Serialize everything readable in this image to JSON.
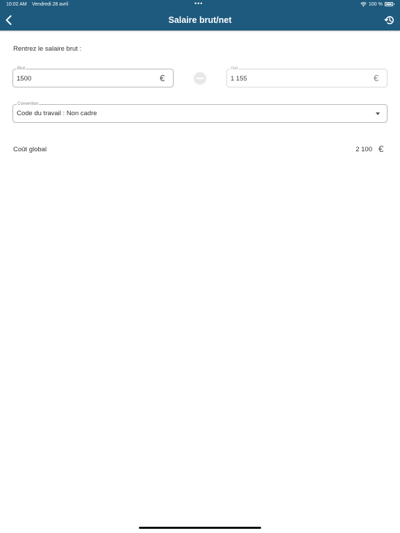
{
  "status_bar": {
    "time": "10:02 AM",
    "date": "Vendredi 28 avril",
    "dots": "•••",
    "battery_pct": "100 %",
    "icons": [
      "wifi-icon",
      "battery-icon"
    ]
  },
  "nav": {
    "title": "Salaire brut/net",
    "back_icon": "chevron-left-icon",
    "history_icon": "history-icon"
  },
  "form": {
    "prompt": "Rentrez le salaire brut :",
    "brut": {
      "legend": "Brut",
      "value": "1500",
      "unit": "€"
    },
    "net": {
      "legend": "Net",
      "value": "1 155",
      "unit": "€"
    },
    "swap_icon": "swap-icon",
    "convention": {
      "legend": "Convention",
      "value": "Code du travail : Non cadre"
    }
  },
  "cost": {
    "label": "Coût global",
    "value": "2 100",
    "unit": "€"
  },
  "colors": {
    "header": "#1e5a7d",
    "border": "#b8b8b8",
    "text": "#333333"
  }
}
